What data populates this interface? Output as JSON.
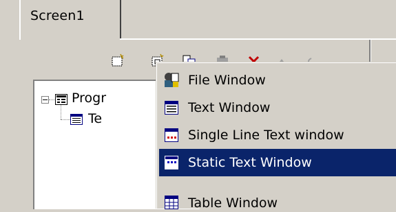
{
  "tabs": [
    {
      "label": "Screen1"
    }
  ],
  "toolbar": {
    "buttons": [
      {
        "icon": "new-window-icon"
      },
      {
        "icon": "new-child-icon"
      },
      {
        "icon": "copy-icon"
      },
      {
        "icon": "paste-icon"
      },
      {
        "icon": "delete-icon"
      },
      {
        "icon": "move-up-icon"
      },
      {
        "icon": "move-down-icon"
      }
    ]
  },
  "tree": {
    "nodes": [
      {
        "label": "Progr",
        "icon": "program-icon"
      },
      {
        "label": "Te",
        "icon": "text-window-icon"
      }
    ]
  },
  "menu": {
    "items": [
      {
        "label": "File Window",
        "icon": "file-window-icon",
        "selected": false
      },
      {
        "label": "Text Window",
        "icon": "text-window-icon",
        "selected": false
      },
      {
        "label": "Single Line Text window",
        "icon": "single-line-text-icon",
        "selected": false
      },
      {
        "label": "Static Text Window",
        "icon": "static-text-icon",
        "selected": true
      },
      {
        "label": "Table Window",
        "icon": "table-window-icon",
        "selected": false
      }
    ]
  },
  "colors": {
    "face": "#d4d0c8",
    "highlight": "#0a246a",
    "white": "#ffffff"
  }
}
